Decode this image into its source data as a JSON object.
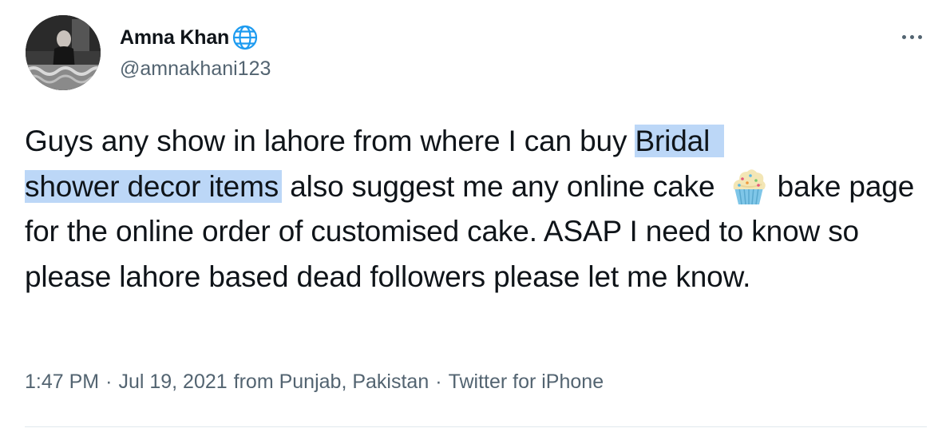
{
  "author": {
    "display_name": "Amna Khan",
    "handle": "@amnakhani123"
  },
  "tweet": {
    "text_pre": "Guys any show in lahore from where I can buy ",
    "highlight_line1": "Bridal",
    "highlight_line2": "shower decor items",
    "text_mid": " also suggest me any online cake ",
    "emoji": "cupcake-emoji",
    "text_post": " bake page for the online order of customised cake. ASAP I need to know so please lahore based dead followers please let me know."
  },
  "meta": {
    "time": "1:47 PM",
    "date": "Jul 19, 2021",
    "location": "from Punjab, Pakistan",
    "source": "Twitter for iPhone",
    "separator": "·"
  },
  "colors": {
    "text": "#0f1419",
    "secondary": "#536471",
    "highlight": "#bcd7f7",
    "globe": "#1d9bf0"
  }
}
